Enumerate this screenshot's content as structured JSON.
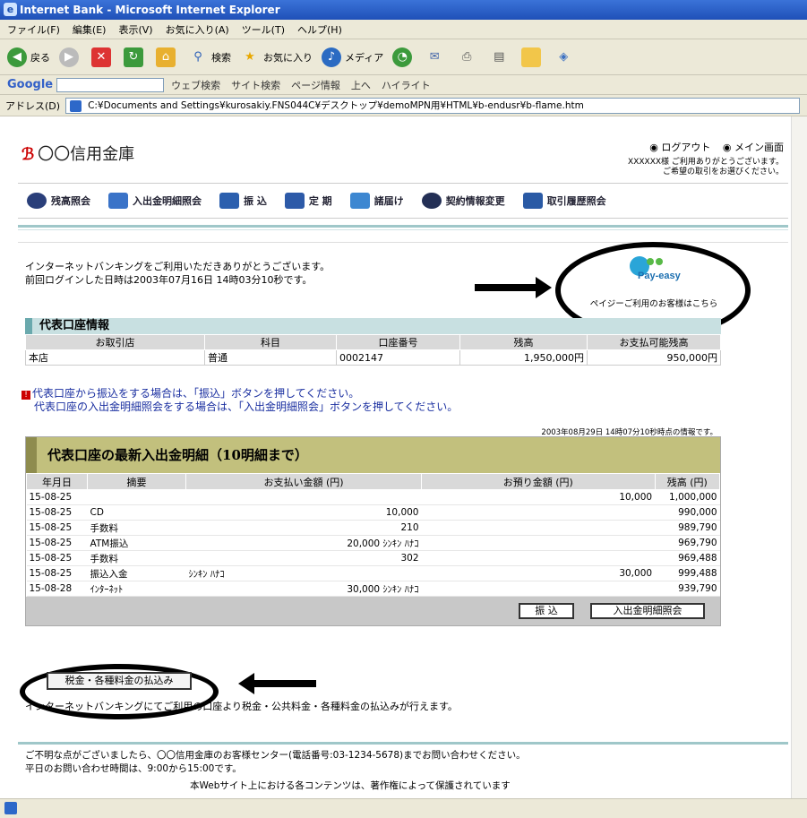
{
  "window": {
    "title": "Internet Bank - Microsoft Internet Explorer"
  },
  "menu": [
    "ファイル(F)",
    "編集(E)",
    "表示(V)",
    "お気に入り(A)",
    "ツール(T)",
    "ヘルプ(H)"
  ],
  "toolbar": {
    "back": "戻る",
    "search": "検索",
    "favorites": "お気に入り",
    "media": "メディア"
  },
  "googlebar": {
    "logo": "Google",
    "web_search": "ウェブ検索",
    "site_search": "サイト検索",
    "page_info": "ページ情報",
    "up": "上へ",
    "highlight": "ハイライト"
  },
  "address": {
    "label": "アドレス(D)",
    "url": "C:¥Documents and Settings¥kurosakiy.FNS044C¥デスクトップ¥demoMPN用¥HTML¥b-endusr¥b-flame.htm"
  },
  "bank": {
    "name": "〇〇信用金庫",
    "mark": "ℬ"
  },
  "header": {
    "logout": "◉ ログアウト",
    "main": "◉ メイン画面",
    "greeting1": "XXXXXX様 ご利用ありがとうございます。",
    "greeting2": "ご希望の取引をお選びください。"
  },
  "nav": [
    {
      "label": "残高照会"
    },
    {
      "label": "入出金明細照会"
    },
    {
      "label": "振 込"
    },
    {
      "label": "定 期"
    },
    {
      "label": "諸届け"
    },
    {
      "label": "契約情報変更"
    },
    {
      "label": "取引履歴照会"
    }
  ],
  "intro": {
    "line1": "インターネットバンキングをご利用いただきありがとうございます。",
    "line2": "前回ログインした日時は2003年07月16日 14時03分10秒です。"
  },
  "payeasy": {
    "logo": "Pay-easy",
    "caption": "ペイジーご利用のお客様はこちら"
  },
  "account": {
    "title": "代表口座情報",
    "headers": [
      "お取引店",
      "科目",
      "口座番号",
      "残高",
      "お支払可能残高"
    ],
    "row": [
      "本店",
      "普通",
      "0002147",
      "1,950,000円",
      "950,000円"
    ]
  },
  "notice": {
    "line1": "代表口座から振込をする場合は、「振込」ボタンを押してください。",
    "line2": "代表口座の入出金明細照会をする場合は、「入出金明細照会」ボタンを押してください。",
    "asof": "2003年08月29日 14時07分10秒時点の情報です。"
  },
  "history": {
    "title": "代表口座の最新入出金明細（10明細まで）",
    "headers": [
      "年月日",
      "摘要",
      "お支払い金額 (円)",
      "お預り金額 (円)",
      "残高 (円)"
    ],
    "rows": [
      [
        "15-08-25",
        "",
        "",
        "",
        "10,000",
        "1,000,000"
      ],
      [
        "15-08-25",
        "CD",
        "",
        "10,000",
        "",
        "990,000"
      ],
      [
        "15-08-25",
        "手数料",
        "",
        "210",
        "",
        "989,790"
      ],
      [
        "15-08-25",
        "ATM振込",
        "",
        "20,000 ｼﾝｷﾝ ﾊﾅｺ",
        "",
        "969,790"
      ],
      [
        "15-08-25",
        "手数料",
        "",
        "302",
        "",
        "969,488"
      ],
      [
        "15-08-25",
        "振込入金",
        "ｼﾝｷﾝ ﾊﾅｺ",
        "",
        "30,000",
        "999,488"
      ],
      [
        "15-08-28",
        "ｲﾝﾀｰﾈｯﾄ",
        "",
        "30,000 ｼﾝｷﾝ ﾊﾅｺ",
        "",
        "939,790"
      ]
    ],
    "transfer_btn": "振 込",
    "statement_btn": "入出金明細照会"
  },
  "tax": {
    "button": "税金・各種料金の払込み",
    "desc": "インターネットバンキングにてご利用の口座より税金・公共料金・各種料金の払込みが行えます。"
  },
  "footer": {
    "line1": "ご不明な点がございましたら、〇〇信用金庫のお客様センター(電話番号:03-1234-5678)までお問い合わせください。",
    "line2": "平日のお問い合わせ時間は、9:00から15:00です。",
    "copyright": "本Webサイト上における各コンテンツは、著作権によって保護されています"
  }
}
